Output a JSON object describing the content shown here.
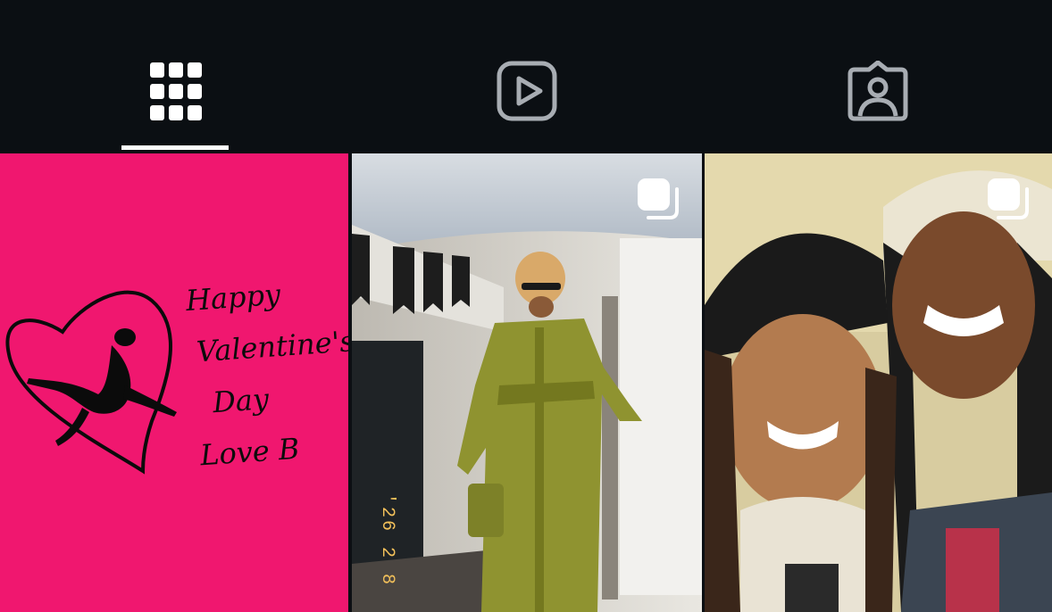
{
  "tabs": [
    {
      "name": "grid-icon",
      "selected": true
    },
    {
      "name": "reels-icon",
      "selected": false
    },
    {
      "name": "tagged-icon",
      "selected": false
    }
  ],
  "posts": [
    {
      "type": "image",
      "background": "#f0176f",
      "text_lines": [
        "Happy",
        "Valentine's",
        "Day",
        "Love B"
      ]
    },
    {
      "type": "carousel",
      "icon": "multiple-photos-icon",
      "date_stamp": "'26 2 8"
    },
    {
      "type": "carousel",
      "icon": "multiple-photos-icon"
    }
  ],
  "colors": {
    "background": "#0b0f13",
    "icon_active": "#ffffff",
    "icon_inactive": "#a8adb3",
    "pink": "#f0176f"
  }
}
